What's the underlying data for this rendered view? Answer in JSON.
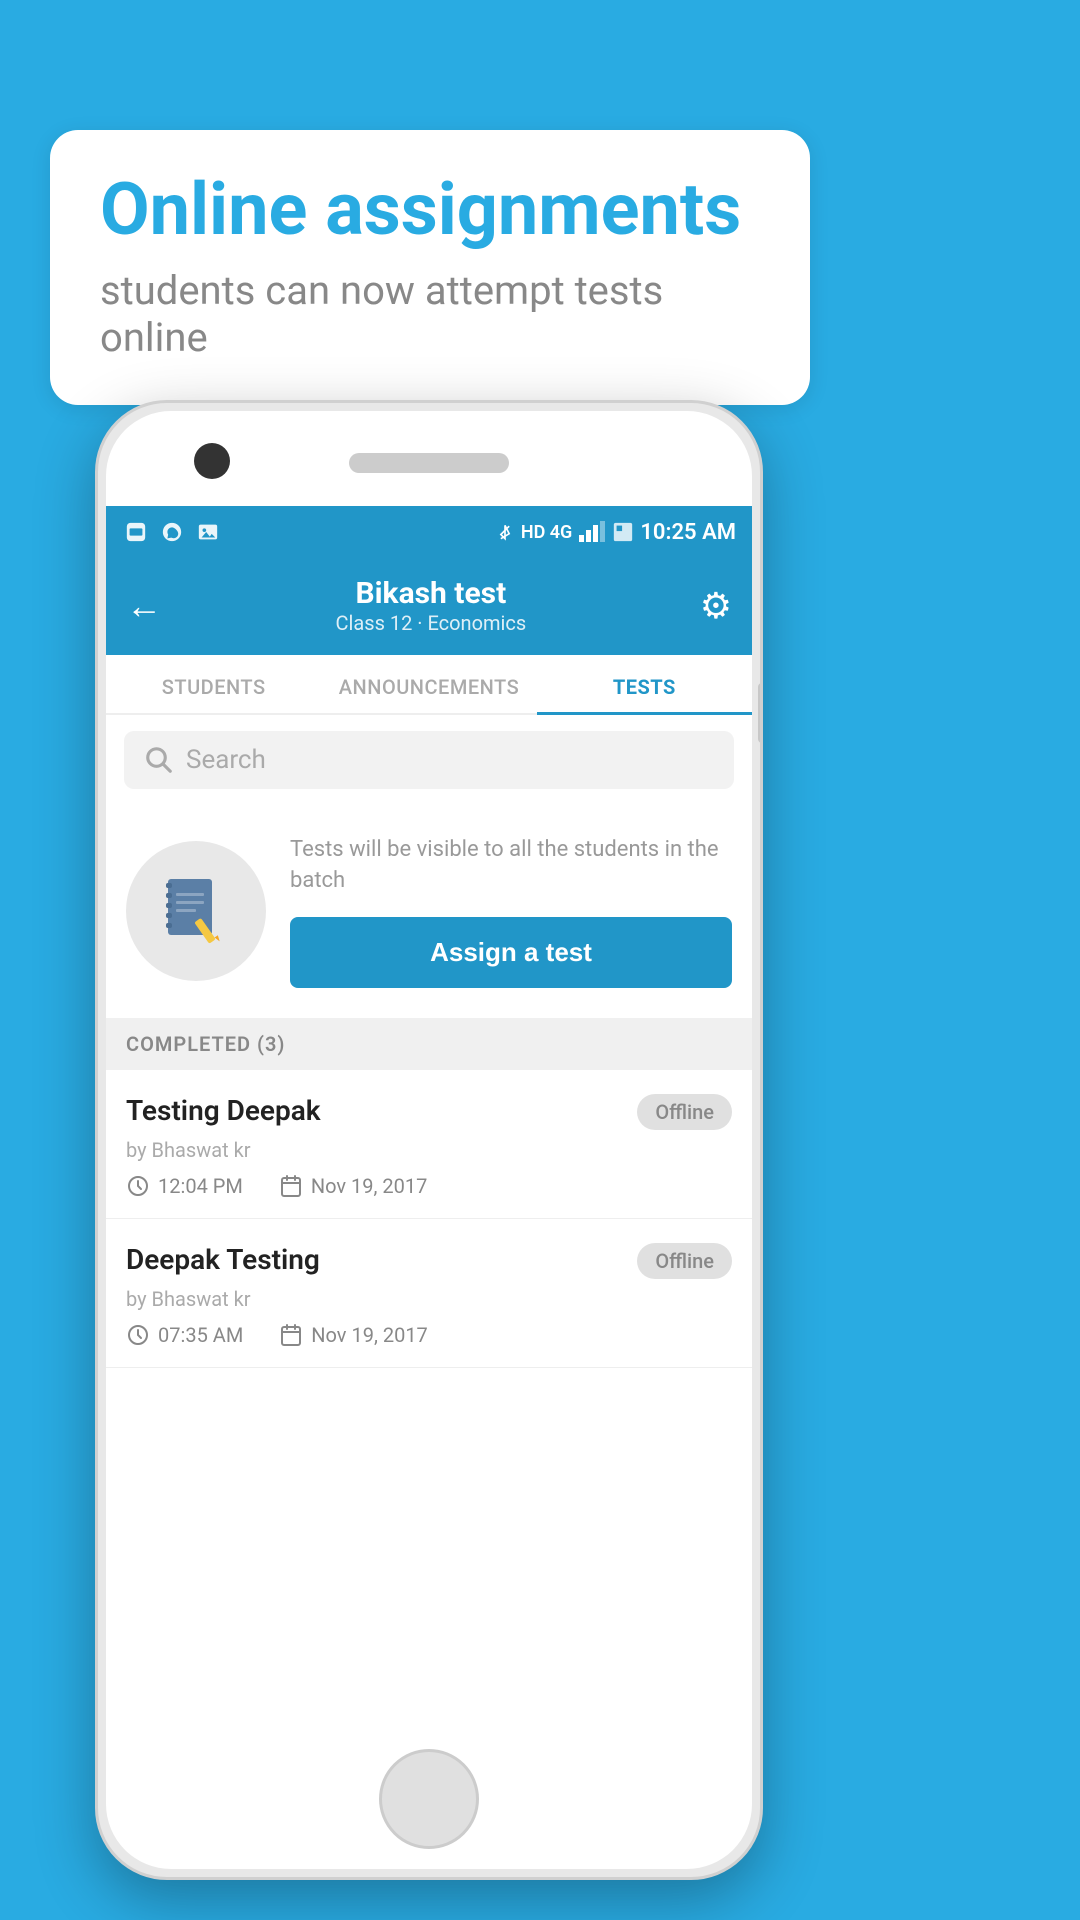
{
  "background_color": "#29ABE2",
  "bubble": {
    "title": "Online assignments",
    "subtitle": "students can now attempt tests online"
  },
  "status_bar": {
    "time": "10:25 AM",
    "network": "HD 4G"
  },
  "top_bar": {
    "title": "Bikash test",
    "subtitle": "Class 12 · Economics",
    "back_label": "←",
    "settings_label": "⚙"
  },
  "tabs": [
    {
      "label": "STUDENTS",
      "active": false
    },
    {
      "label": "ANNOUNCEMENTS",
      "active": false
    },
    {
      "label": "TESTS",
      "active": true
    }
  ],
  "search": {
    "placeholder": "Search"
  },
  "info": {
    "description": "Tests will be visible to all the students in the batch",
    "assign_button": "Assign a test"
  },
  "completed_section": {
    "header": "COMPLETED (3)",
    "items": [
      {
        "title": "Testing Deepak",
        "author": "by Bhaswat kr",
        "time": "12:04 PM",
        "date": "Nov 19, 2017",
        "badge": "Offline"
      },
      {
        "title": "Deepak Testing",
        "author": "by Bhaswat kr",
        "time": "07:35 AM",
        "date": "Nov 19, 2017",
        "badge": "Offline"
      }
    ]
  }
}
